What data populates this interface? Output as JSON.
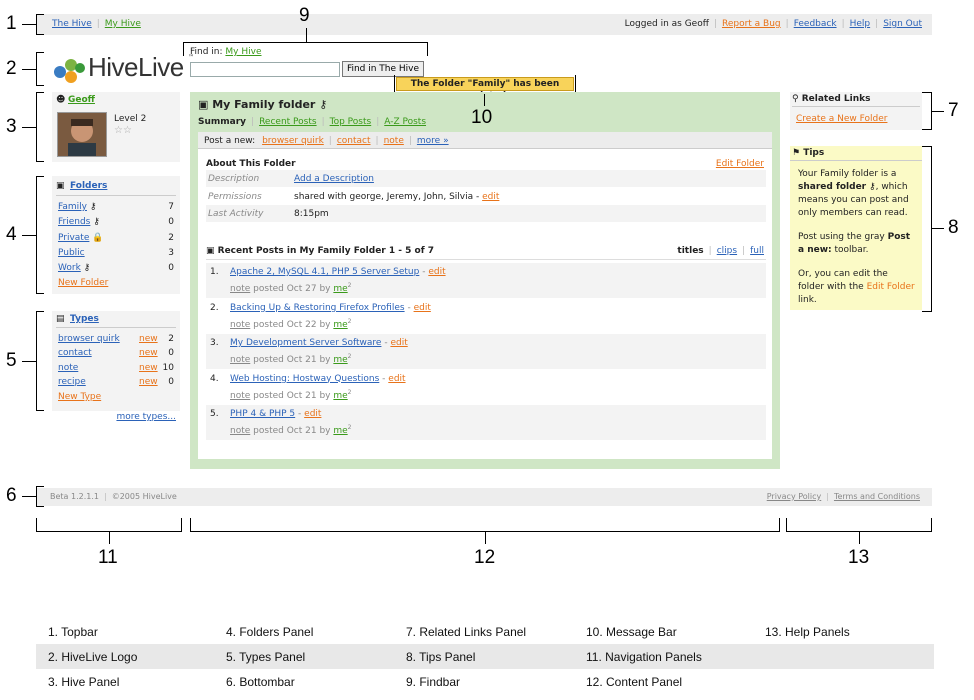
{
  "topbar": {
    "the_hive": "The Hive",
    "my_hive": "My Hive",
    "logged_in": "Logged in as Geoff",
    "report_bug": "Report a Bug",
    "feedback": "Feedback",
    "help": "Help",
    "sign_out": "Sign Out"
  },
  "logo": {
    "text": "HiveLive",
    "tm": "™"
  },
  "findbar": {
    "label": "Find in:",
    "scope": "My Hive",
    "button": "Find in The Hive",
    "input_value": ""
  },
  "message": "The Folder \"Family\" has been updated",
  "hive": {
    "user": "Geoff",
    "level": "Level 2",
    "stars": "☆☆"
  },
  "folders": {
    "title": "Folders",
    "items": [
      {
        "name": "Family",
        "count": "7"
      },
      {
        "name": "Friends",
        "count": "0"
      },
      {
        "name": "Private",
        "count": "2"
      },
      {
        "name": "Public",
        "count": "3"
      },
      {
        "name": "Work",
        "count": "0"
      }
    ],
    "new": "New Folder"
  },
  "types": {
    "title": "Types",
    "items": [
      {
        "name": "browser quirk",
        "new": "new",
        "count": "2"
      },
      {
        "name": "contact",
        "new": "new",
        "count": "0"
      },
      {
        "name": "note",
        "new": "new",
        "count": "10"
      },
      {
        "name": "recipe",
        "new": "new",
        "count": "0"
      }
    ],
    "new": "New Type",
    "more": "more types..."
  },
  "content": {
    "title": "My Family folder",
    "tabs": [
      "Summary",
      "Recent Posts",
      "Top Posts",
      "A-Z Posts"
    ],
    "post_new_label": "Post a new:",
    "post_new": [
      "browser quirk",
      "contact",
      "note",
      "more »"
    ],
    "about": {
      "title": "About This Folder",
      "edit": "Edit Folder",
      "description_label": "Description",
      "description_value": "Add a Description",
      "permissions_label": "Permissions",
      "permissions_value": "shared with george, Jeremy, John, Silvia - ",
      "permissions_edit": "edit",
      "activity_label": "Last Activity",
      "activity_value": "8:15pm"
    },
    "recent": {
      "title": "Recent Posts in My Family Folder 1 - 5 of 7",
      "views": [
        "titles",
        "clips",
        "full"
      ],
      "posts": [
        {
          "n": "1.",
          "title": "Apache 2, MySQL 4.1, PHP 5 Server Setup",
          "type": "note",
          "meta": "posted Oct 27 by",
          "by": "me",
          "sup": "2"
        },
        {
          "n": "2.",
          "title": "Backing Up & Restoring Firefox Profiles",
          "type": "note",
          "meta": "posted Oct 22 by",
          "by": "me",
          "sup": "2"
        },
        {
          "n": "3.",
          "title": "My Development Server Software",
          "type": "note",
          "meta": "posted Oct 21 by",
          "by": "me",
          "sup": "2"
        },
        {
          "n": "4.",
          "title": "Web Hosting: Hostway Questions",
          "type": "note",
          "meta": "posted Oct 21 by",
          "by": "me",
          "sup": "2"
        },
        {
          "n": "5.",
          "title": "PHP 4 & PHP 5",
          "type": "note",
          "meta": "posted Oct 21 by",
          "by": "me",
          "sup": "2"
        }
      ],
      "edit": "edit",
      "dash": " - "
    }
  },
  "related": {
    "title": "Related Links",
    "link": "Create a New Folder"
  },
  "tips": {
    "title": "Tips",
    "p1a": "Your Family folder is a ",
    "p1b": "shared folder",
    "p1c": ", which means you can post and only members can read.",
    "p2a": "Post using the gray ",
    "p2b": "Post a new:",
    "p2c": " toolbar.",
    "p3a": "Or, you can edit the folder with the ",
    "p3b": "Edit Folder",
    "p3c": " link."
  },
  "bottombar": {
    "version": "Beta 1.2.1.1",
    "copyright": "©2005 HiveLive",
    "privacy": "Privacy Policy",
    "terms": "Terms and Conditions"
  },
  "callouts": [
    "1",
    "2",
    "3",
    "4",
    "5",
    "6",
    "7",
    "8",
    "9",
    "10",
    "11",
    "12",
    "13"
  ],
  "legend": [
    [
      "1. Topbar",
      "4. Folders Panel",
      "7. Related Links Panel",
      "10. Message Bar",
      "13. Help Panels"
    ],
    [
      "2. HiveLive Logo",
      "5. Types Panel",
      "8. Tips Panel",
      "11. Navigation Panels",
      ""
    ],
    [
      "3. Hive Panel",
      "6. Bottombar",
      "9. Findbar",
      "12. Content Panel",
      ""
    ]
  ],
  "colors": {
    "link": "#2b62b8",
    "orange": "#e8731a",
    "green": "#3a9a1a",
    "content_bg": "#cfe6c5",
    "tips_bg": "#fbfac6",
    "message_bg": "#f8d35a"
  }
}
